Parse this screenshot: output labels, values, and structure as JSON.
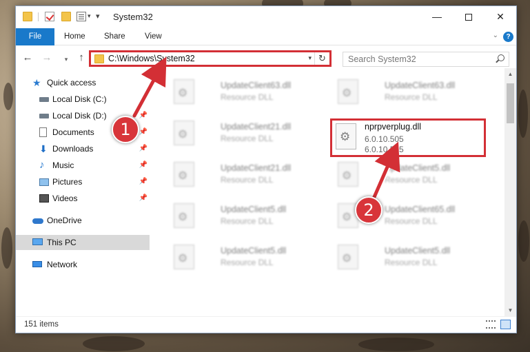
{
  "window": {
    "title": "System32",
    "controls": {
      "minimize": "—",
      "maximize": "",
      "close": "✕"
    }
  },
  "ribbon": {
    "tabs": [
      "File",
      "Home",
      "Share",
      "View"
    ],
    "collapse_icon": "chevron-down-icon",
    "help": "?"
  },
  "nav": {
    "back": "←",
    "forward": "→",
    "recent": "▾",
    "up": "↑"
  },
  "address": {
    "path": "C:\\Windows\\System32",
    "dropdown": "▾",
    "refresh": "↻"
  },
  "search": {
    "placeholder": "Search System32"
  },
  "sidebar": {
    "items": [
      {
        "label": "Quick access",
        "icon": "star-icon",
        "pinned": false
      },
      {
        "label": "Local Disk (C:)",
        "icon": "drive-icon",
        "pinned": false
      },
      {
        "label": "Local Disk (D:)",
        "icon": "drive-icon",
        "pinned": true
      },
      {
        "label": "Documents",
        "icon": "documents-icon",
        "pinned": true
      },
      {
        "label": "Downloads",
        "icon": "download-icon",
        "pinned": true
      },
      {
        "label": "Music",
        "icon": "music-icon",
        "pinned": true
      },
      {
        "label": "Pictures",
        "icon": "pictures-icon",
        "pinned": true
      },
      {
        "label": "Videos",
        "icon": "video-icon",
        "pinned": true
      },
      {
        "label": "OneDrive",
        "icon": "cloud-icon",
        "pinned": false
      },
      {
        "label": "This PC",
        "icon": "computer-icon",
        "pinned": false,
        "selected": true
      },
      {
        "label": "Network",
        "icon": "network-icon",
        "pinned": false
      }
    ],
    "pin_glyph": "📌"
  },
  "files": [
    {
      "name": "UpdateClient63.dll",
      "desc": "Resource DLL"
    },
    {
      "name": "UpdateClient63.dll",
      "desc": "Resource DLL"
    },
    {
      "name": "UpdateClient21.dll",
      "desc": "Resource DLL"
    },
    {
      "name": "UpdateClient21.dll",
      "desc": "Resource DLL"
    },
    {
      "name": "UpdateClient5.dll",
      "desc": "Resource DLL"
    },
    {
      "name": "UpdateClient5.dll",
      "desc": "Resource DLL"
    },
    {
      "name": "UpdateClient65.dll",
      "desc": "Resource DLL"
    },
    {
      "name": "UpdateClient5.dll",
      "desc": "Resource DLL"
    },
    {
      "name": "UpdateClient5.dll",
      "desc": "Resource DLL"
    }
  ],
  "highlighted_file": {
    "name": "nprpverplug.dll",
    "version": "6.0.10.505",
    "file_version": "6.0.10.505"
  },
  "status": {
    "item_count": "151 items"
  },
  "annotations": {
    "step1": "1",
    "step2": "2",
    "color": "#d32f35"
  }
}
